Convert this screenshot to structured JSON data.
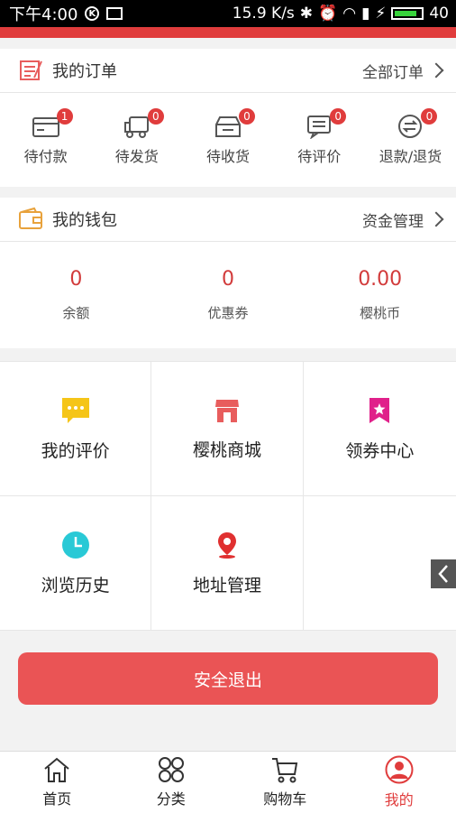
{
  "status_bar": {
    "time": "下午4:00",
    "speed": "15.9 K/s",
    "signal_text": "40"
  },
  "orders": {
    "title": "我的订单",
    "more": "全部订单",
    "items": [
      {
        "label": "待付款",
        "badge": "1",
        "icon": "card-icon"
      },
      {
        "label": "待发货",
        "badge": "0",
        "icon": "truck-icon"
      },
      {
        "label": "待收货",
        "badge": "0",
        "icon": "box-icon"
      },
      {
        "label": "待评价",
        "badge": "0",
        "icon": "comment-icon"
      },
      {
        "label": "退款/退货",
        "badge": "0",
        "icon": "refund-icon"
      }
    ]
  },
  "wallet": {
    "title": "我的钱包",
    "more": "资金管理",
    "items": [
      {
        "value": "0",
        "label": "余额"
      },
      {
        "value": "0",
        "label": "优惠券"
      },
      {
        "value": "0.00",
        "label": "樱桃币"
      }
    ]
  },
  "grid": {
    "items": [
      {
        "label": "我的评价",
        "icon": "chat-bubble-icon",
        "color": "#f5c518"
      },
      {
        "label": "樱桃商城",
        "icon": "store-icon",
        "color": "#e85d5d"
      },
      {
        "label": "领券中心",
        "icon": "bookmark-star-icon",
        "color": "#e0208a"
      },
      {
        "label": "浏览历史",
        "icon": "clock-icon",
        "color": "#29c9d6"
      },
      {
        "label": "地址管理",
        "icon": "location-pin-icon",
        "color": "#e03030"
      }
    ]
  },
  "logout_label": "安全退出",
  "tabs": [
    {
      "label": "首页",
      "icon": "home-icon"
    },
    {
      "label": "分类",
      "icon": "grid-icon"
    },
    {
      "label": "购物车",
      "icon": "cart-icon"
    },
    {
      "label": "我的",
      "icon": "user-icon",
      "active": true
    }
  ],
  "colors": {
    "accent": "#e03c3c",
    "logout": "#ea5455"
  }
}
